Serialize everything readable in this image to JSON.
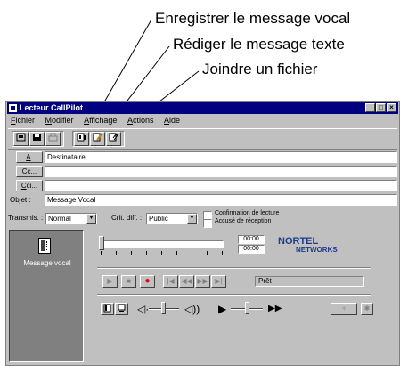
{
  "callouts": {
    "record": "Enregistrer le message vocal",
    "compose": "Rédiger le message texte",
    "attach": "Joindre un fichier"
  },
  "window": {
    "title": "Lecteur CallPilot",
    "min_label": "_",
    "max_label": "□",
    "close_label": "×"
  },
  "menu": {
    "items": [
      {
        "u": "F",
        "rest": "ichier"
      },
      {
        "u": "M",
        "rest": "odifier"
      },
      {
        "u": "A",
        "rest": "ffichage"
      },
      {
        "u": "A",
        "rest": "ctions"
      },
      {
        "u": "A",
        "rest": "ide"
      }
    ]
  },
  "toolbar": {
    "send_icon": "send-icon",
    "save_icon": "save-icon",
    "print_icon": "print-icon",
    "record_icon": "record-voice-icon",
    "compose_icon": "compose-text-icon",
    "attach_icon": "attach-file-icon"
  },
  "header": {
    "to_u": "A",
    "to_rest": ".",
    "to_value": "Destinataire",
    "cc_u": "C",
    "cc_rest": "c...",
    "cc_value": "",
    "bcc_u": "C",
    "bcc_rest": "ci...",
    "bcc_value": "",
    "subject_label": "Objet :",
    "subject_value": "Message Vocal"
  },
  "options": {
    "transmis_label": "Transmis. :",
    "transmis_value": "Normal",
    "crit_label": "Crit. diff. :",
    "crit_value": "Public",
    "read_confirm": "Confirmation de lecture",
    "receipt": "Accusé de réception"
  },
  "left_panel": {
    "label": "Message vocal"
  },
  "player": {
    "time_elapsed": "00:00",
    "time_total": "00:00",
    "logo_line1": "NORTEL",
    "logo_line2": "NETWORKS",
    "status": "Prêt",
    "position": 0
  }
}
